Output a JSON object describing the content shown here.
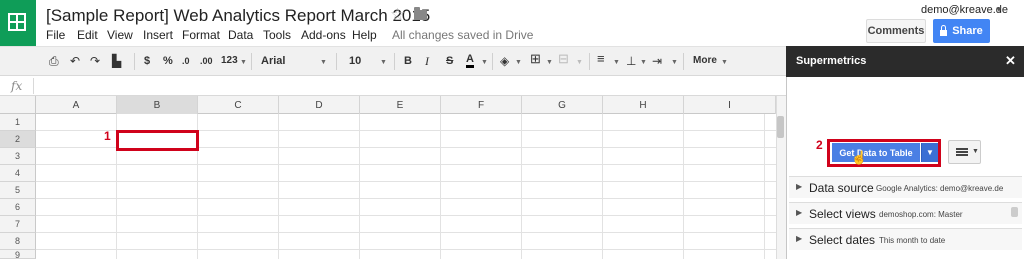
{
  "header": {
    "doc_title": "[Sample Report] Web Analytics Report March 2015",
    "saved_status": "All changes saved in Drive",
    "account_email": "demo@kreave.de",
    "comments_label": "Comments",
    "share_label": "Share"
  },
  "menu": [
    "File",
    "Edit",
    "View",
    "Insert",
    "Format",
    "Data",
    "Tools",
    "Add-ons",
    "Help"
  ],
  "toolbar": {
    "currency": "$",
    "percent": "%",
    "decrease_decimals": ".0",
    "increase_decimals": ".00",
    "number_format": "123",
    "font": "Arial",
    "font_size": "10",
    "bold": "B",
    "italic": "I",
    "strikethrough": "S",
    "text_color": "A",
    "more": "More"
  },
  "formula_bar": {
    "fx": "fx"
  },
  "grid": {
    "columns": [
      "A",
      "B",
      "C",
      "D",
      "E",
      "F",
      "G",
      "H",
      "I"
    ],
    "rows": [
      "1",
      "2",
      "3",
      "4",
      "5",
      "6",
      "7",
      "8",
      "9"
    ],
    "callout_1": "1"
  },
  "sidebar": {
    "title": "Supermetrics",
    "close": "✕",
    "callout_2": "2",
    "get_data_label": "Get Data to Table",
    "sections": [
      {
        "name": "Data source",
        "value": "Google Analytics: demo@kreave.de"
      },
      {
        "name": "Select views",
        "value": "demoshop.com: Master"
      },
      {
        "name": "Select dates",
        "value": "This month to date"
      }
    ]
  },
  "colors": {
    "sheets_green": "#0f9d58",
    "share_blue": "#4285f4",
    "annotation_red": "#d0021b",
    "sidebar_header": "#2b2b2b"
  }
}
